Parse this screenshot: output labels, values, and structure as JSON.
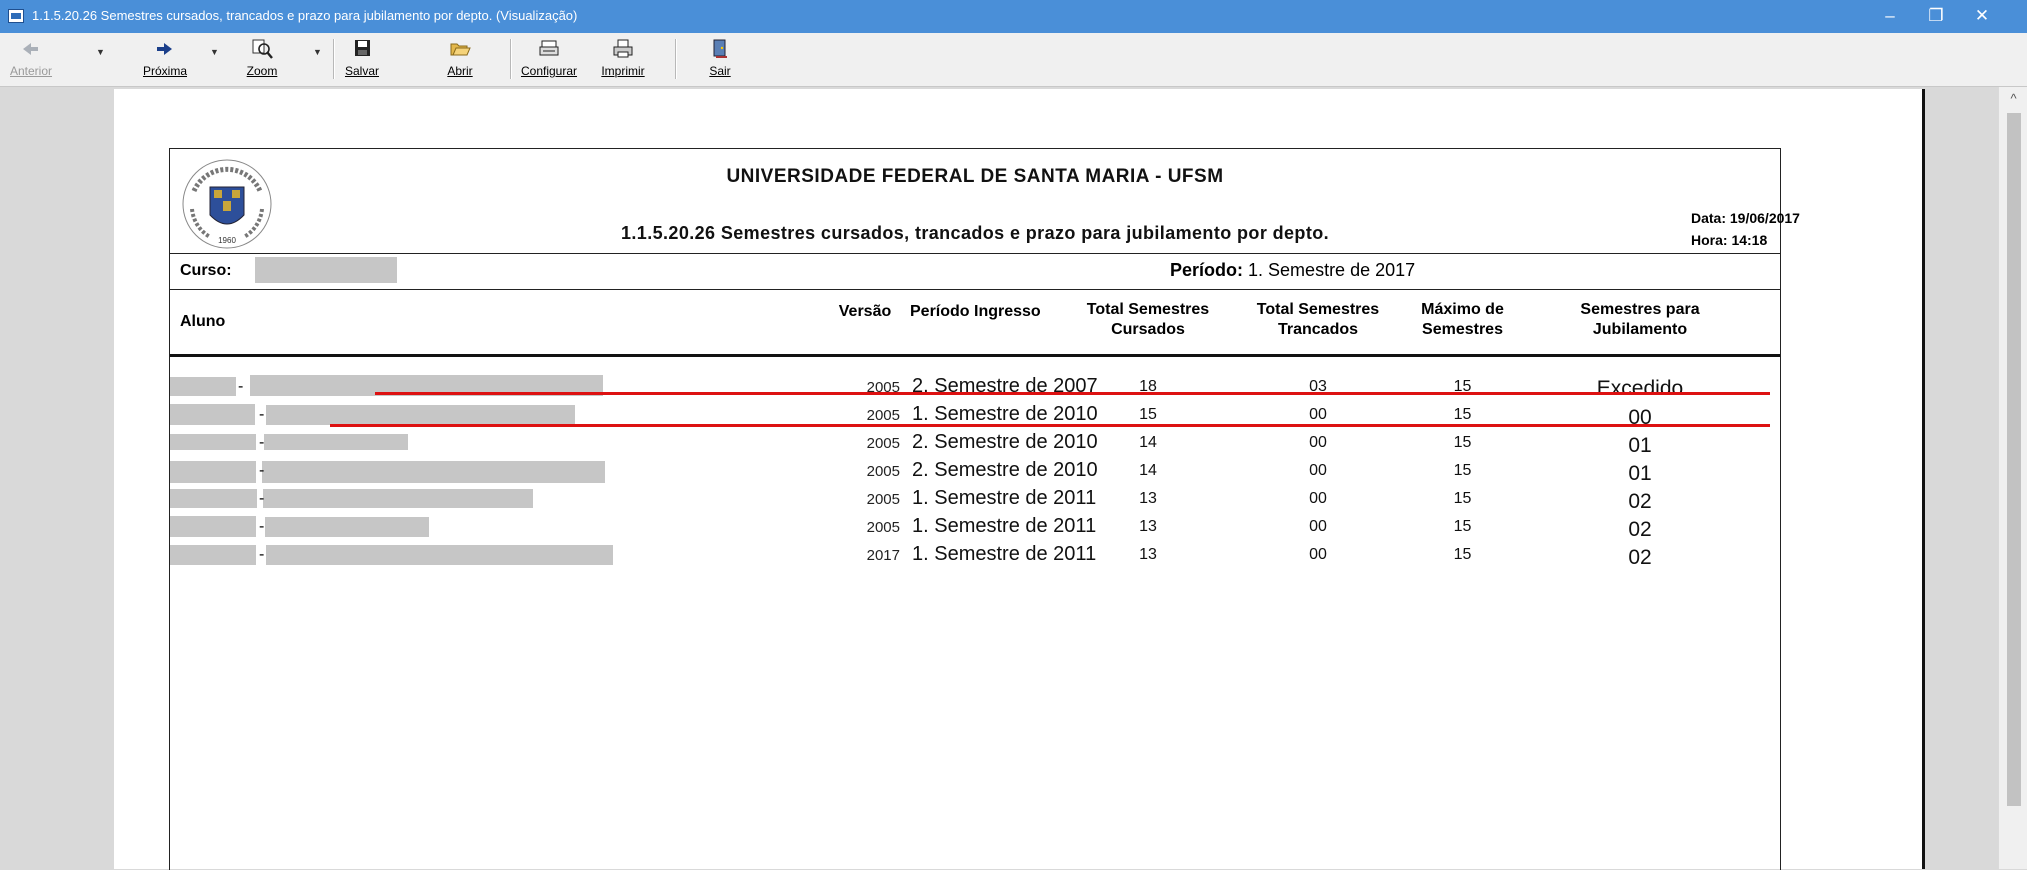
{
  "window": {
    "title": "1.1.5.20.26 Semestres cursados, trancados e prazo para jubilamento por depto. (Visualização)",
    "minimize": "–",
    "restore": "❐",
    "close": "✕"
  },
  "toolbar": {
    "anterior": "Anterior",
    "proxima": "Próxima",
    "zoom": "Zoom",
    "salvar": "Salvar",
    "abrir": "Abrir",
    "configurar": "Configurar",
    "imprimir": "Imprimir",
    "sair": "Sair"
  },
  "report": {
    "university": "UNIVERSIDADE FEDERAL DE SANTA MARIA - UFSM",
    "title": "1.1.5.20.26 Semestres cursados, trancados e prazo para jubilamento por depto.",
    "date": "Data: 19/06/2017",
    "time": "Hora: 14:18",
    "curso_label": "Curso:",
    "periodo_label": "Período:",
    "periodo_value": "1. Semestre de 2017",
    "logo_year": "1960",
    "columns": {
      "aluno": "Aluno",
      "versao": "Versão",
      "periodo_ingresso": "Período Ingresso",
      "total_cursados": "Total Semestres Cursados",
      "total_trancados": "Total Semestres Trancados",
      "maximo": "Máximo de Semestres",
      "jubilamento": "Semestres para Jubilamento"
    },
    "rows": [
      {
        "versao": "2005",
        "periodo": "2. Semestre de 2007",
        "cursados": "18",
        "trancados": "03",
        "maximo": "15",
        "jubilamento": "Excedido"
      },
      {
        "versao": "2005",
        "periodo": "1. Semestre de 2010",
        "cursados": "15",
        "trancados": "00",
        "maximo": "15",
        "jubilamento": "00"
      },
      {
        "versao": "2005",
        "periodo": "2. Semestre de 2010",
        "cursados": "14",
        "trancados": "00",
        "maximo": "15",
        "jubilamento": "01"
      },
      {
        "versao": "2005",
        "periodo": "2. Semestre de 2010",
        "cursados": "14",
        "trancados": "00",
        "maximo": "15",
        "jubilamento": "01"
      },
      {
        "versao": "2005",
        "periodo": "1. Semestre de 2011",
        "cursados": "13",
        "trancados": "00",
        "maximo": "15",
        "jubilamento": "02"
      },
      {
        "versao": "2005",
        "periodo": "1. Semestre de 2011",
        "cursados": "13",
        "trancados": "00",
        "maximo": "15",
        "jubilamento": "02"
      },
      {
        "versao": "2017",
        "periodo": "1. Semestre de 2011",
        "cursados": "13",
        "trancados": "00",
        "maximo": "15",
        "jubilamento": "02"
      }
    ]
  },
  "colors": {
    "titlebar": "#4a8fd8",
    "highlight_line": "#dd1111",
    "redaction": "#c6c6c6"
  }
}
